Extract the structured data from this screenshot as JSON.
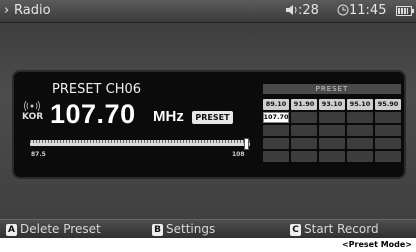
{
  "topbar": {
    "title": "Radio",
    "volume": "28",
    "time": "11:45"
  },
  "tuner": {
    "preset_channel": "PRESET CH06",
    "region": "KOR",
    "frequency": "107.70",
    "unit": "MHz",
    "badge": "PRESET",
    "scale_min": "87.5",
    "scale_max": "108",
    "position_fraction": 0.98
  },
  "presets": {
    "header": "PRESET",
    "rows": [
      [
        "89.10",
        "91.90",
        "93.10",
        "95.10",
        "95.90"
      ],
      [
        "107.70",
        "",
        "",
        "",
        ""
      ],
      [
        "",
        "",
        "",
        "",
        ""
      ],
      [
        "",
        "",
        "",
        "",
        ""
      ],
      [
        "",
        "",
        "",
        "",
        ""
      ]
    ],
    "selected": "107.70"
  },
  "softkeys": [
    {
      "key": "A",
      "label": "Delete Preset"
    },
    {
      "key": "B",
      "label": "Settings"
    },
    {
      "key": "C",
      "label": "Start Record"
    }
  ],
  "caption": "<Preset Mode>"
}
